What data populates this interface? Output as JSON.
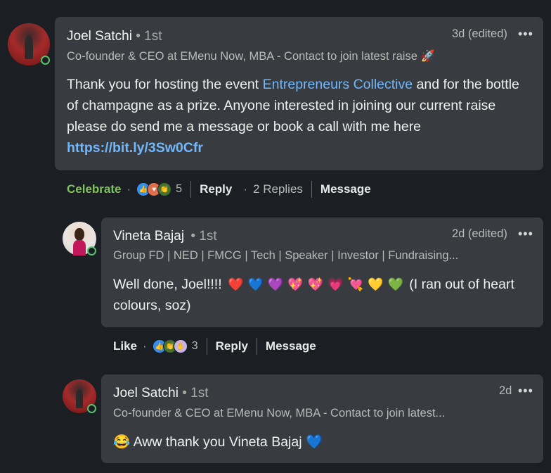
{
  "comment1": {
    "name": "Joel Satchi",
    "degree": "• 1st",
    "time": "3d (edited)",
    "more": "•••",
    "headline": "Co-founder & CEO at EMenu Now, MBA - Contact to join latest raise 🚀",
    "body_pre": "Thank you for hosting the event ",
    "body_link": "Entrepreneurs Collective",
    "body_mid": " and for the bottle of champagne as a prize. Anyone interested in joining our current raise please do send me a message or book a call with me here ",
    "body_url": "https://bit.ly/3Sw0Cfr",
    "actions": {
      "react": "Celebrate",
      "count": "5",
      "reply": "Reply",
      "replies": "2 Replies",
      "message": "Message"
    }
  },
  "comment2": {
    "name": "Vineta Bajaj",
    "degree": "• 1st",
    "time": "2d (edited)",
    "more": "•••",
    "headline": "Group FD | NED | FMCG | Tech | Speaker | Investor | Fundraising...",
    "body_pre": "Well done, Joel!!!! ",
    "hearts": [
      "❤️",
      "💙",
      "💜",
      "💖",
      "💖",
      "💗",
      "💘",
      "💛",
      "💚"
    ],
    "body_post": " (I ran out of heart colours, soz)",
    "actions": {
      "react": "Like",
      "count": "3",
      "reply": "Reply",
      "message": "Message"
    }
  },
  "comment3": {
    "name": "Joel Satchi",
    "degree": "• 1st",
    "time": "2d",
    "more": "•••",
    "headline": "Co-founder & CEO at EMenu Now, MBA - Contact to join latest...",
    "emoji_pre": "😂",
    "body": " Aww thank you Vineta Bajaj ",
    "emoji_post": "💙"
  },
  "colors": {
    "background": "#1b1f23",
    "bubble": "#383c40",
    "link": "#71b7fb",
    "celebrate": "#7fc15e",
    "online": "#57c26a"
  }
}
